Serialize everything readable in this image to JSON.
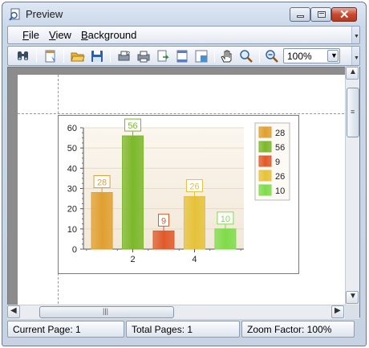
{
  "window": {
    "title": "Preview"
  },
  "menu": {
    "items": [
      "File",
      "View",
      "Background"
    ]
  },
  "toolbar": {
    "buttons": [
      "find-icon",
      "page-setup-icon",
      "open-icon",
      "save-icon",
      "print-dialog-icon",
      "print-icon",
      "export-icon",
      "header-footer-icon",
      "scale-icon",
      "hand-tool-icon",
      "magnifier-icon",
      "zoom-out-icon"
    ],
    "zoom_value": "100%"
  },
  "status": {
    "current_page": "Current Page: 1",
    "total_pages": "Total Pages: 1",
    "zoom_factor": "Zoom Factor: 100%"
  },
  "chart_data": {
    "type": "bar",
    "categories": [
      1,
      2,
      3,
      4,
      5
    ],
    "x_tick_labels": [
      "2",
      "4"
    ],
    "values": [
      28,
      56,
      9,
      26,
      10
    ],
    "data_labels": [
      "28",
      "56",
      "9",
      "26",
      "10"
    ],
    "colors": [
      "#e0a030",
      "#7cb82a",
      "#e05a2a",
      "#e6c23a",
      "#7fdc4a"
    ],
    "legend": [
      "28",
      "56",
      "9",
      "26",
      "10"
    ],
    "legend_position": "right",
    "ylim": [
      0,
      60
    ],
    "y_ticks": [
      "0",
      "10",
      "20",
      "30",
      "40",
      "50",
      "60"
    ],
    "title": "",
    "xlabel": "",
    "ylabel": ""
  }
}
